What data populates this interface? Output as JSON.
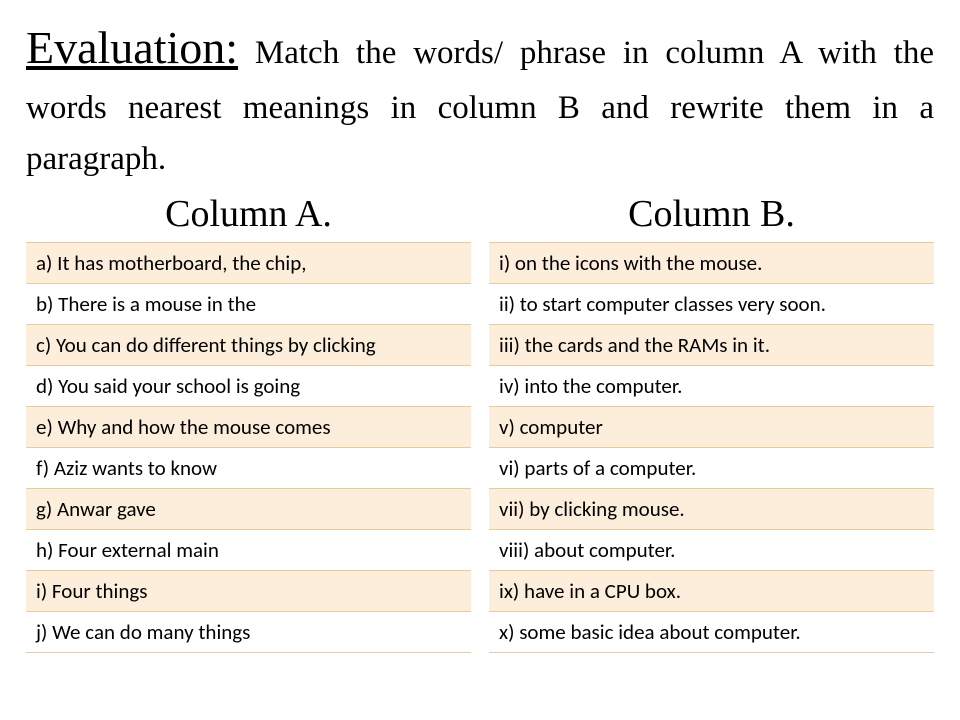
{
  "heading": {
    "label": "Evaluation:",
    "text": " Match the words/ phrase in column A with the words nearest meanings in column B and rewrite them in a paragraph."
  },
  "columns": {
    "a_heading": "Column A.",
    "b_heading": "Column B."
  },
  "column_a": [
    "a) It has motherboard, the chip,",
    "b) There is a mouse in the",
    "c) You can do different things by clicking",
    "d) You said your school is going",
    "e) Why and how the mouse comes",
    "f) Aziz wants to know",
    "g) Anwar gave",
    "h) Four external main",
    "i) Four things",
    "j) We can do many things"
  ],
  "column_b": [
    "i) on the icons with the mouse.",
    "ii) to start computer classes very soon.",
    "iii) the cards and the RAMs in it.",
    "iv) into the computer.",
    "v) computer",
    "vi) parts of a computer.",
    "vii) by clicking mouse.",
    "viii) about computer.",
    "ix) have in a CPU box.",
    "x) some basic idea about computer."
  ]
}
